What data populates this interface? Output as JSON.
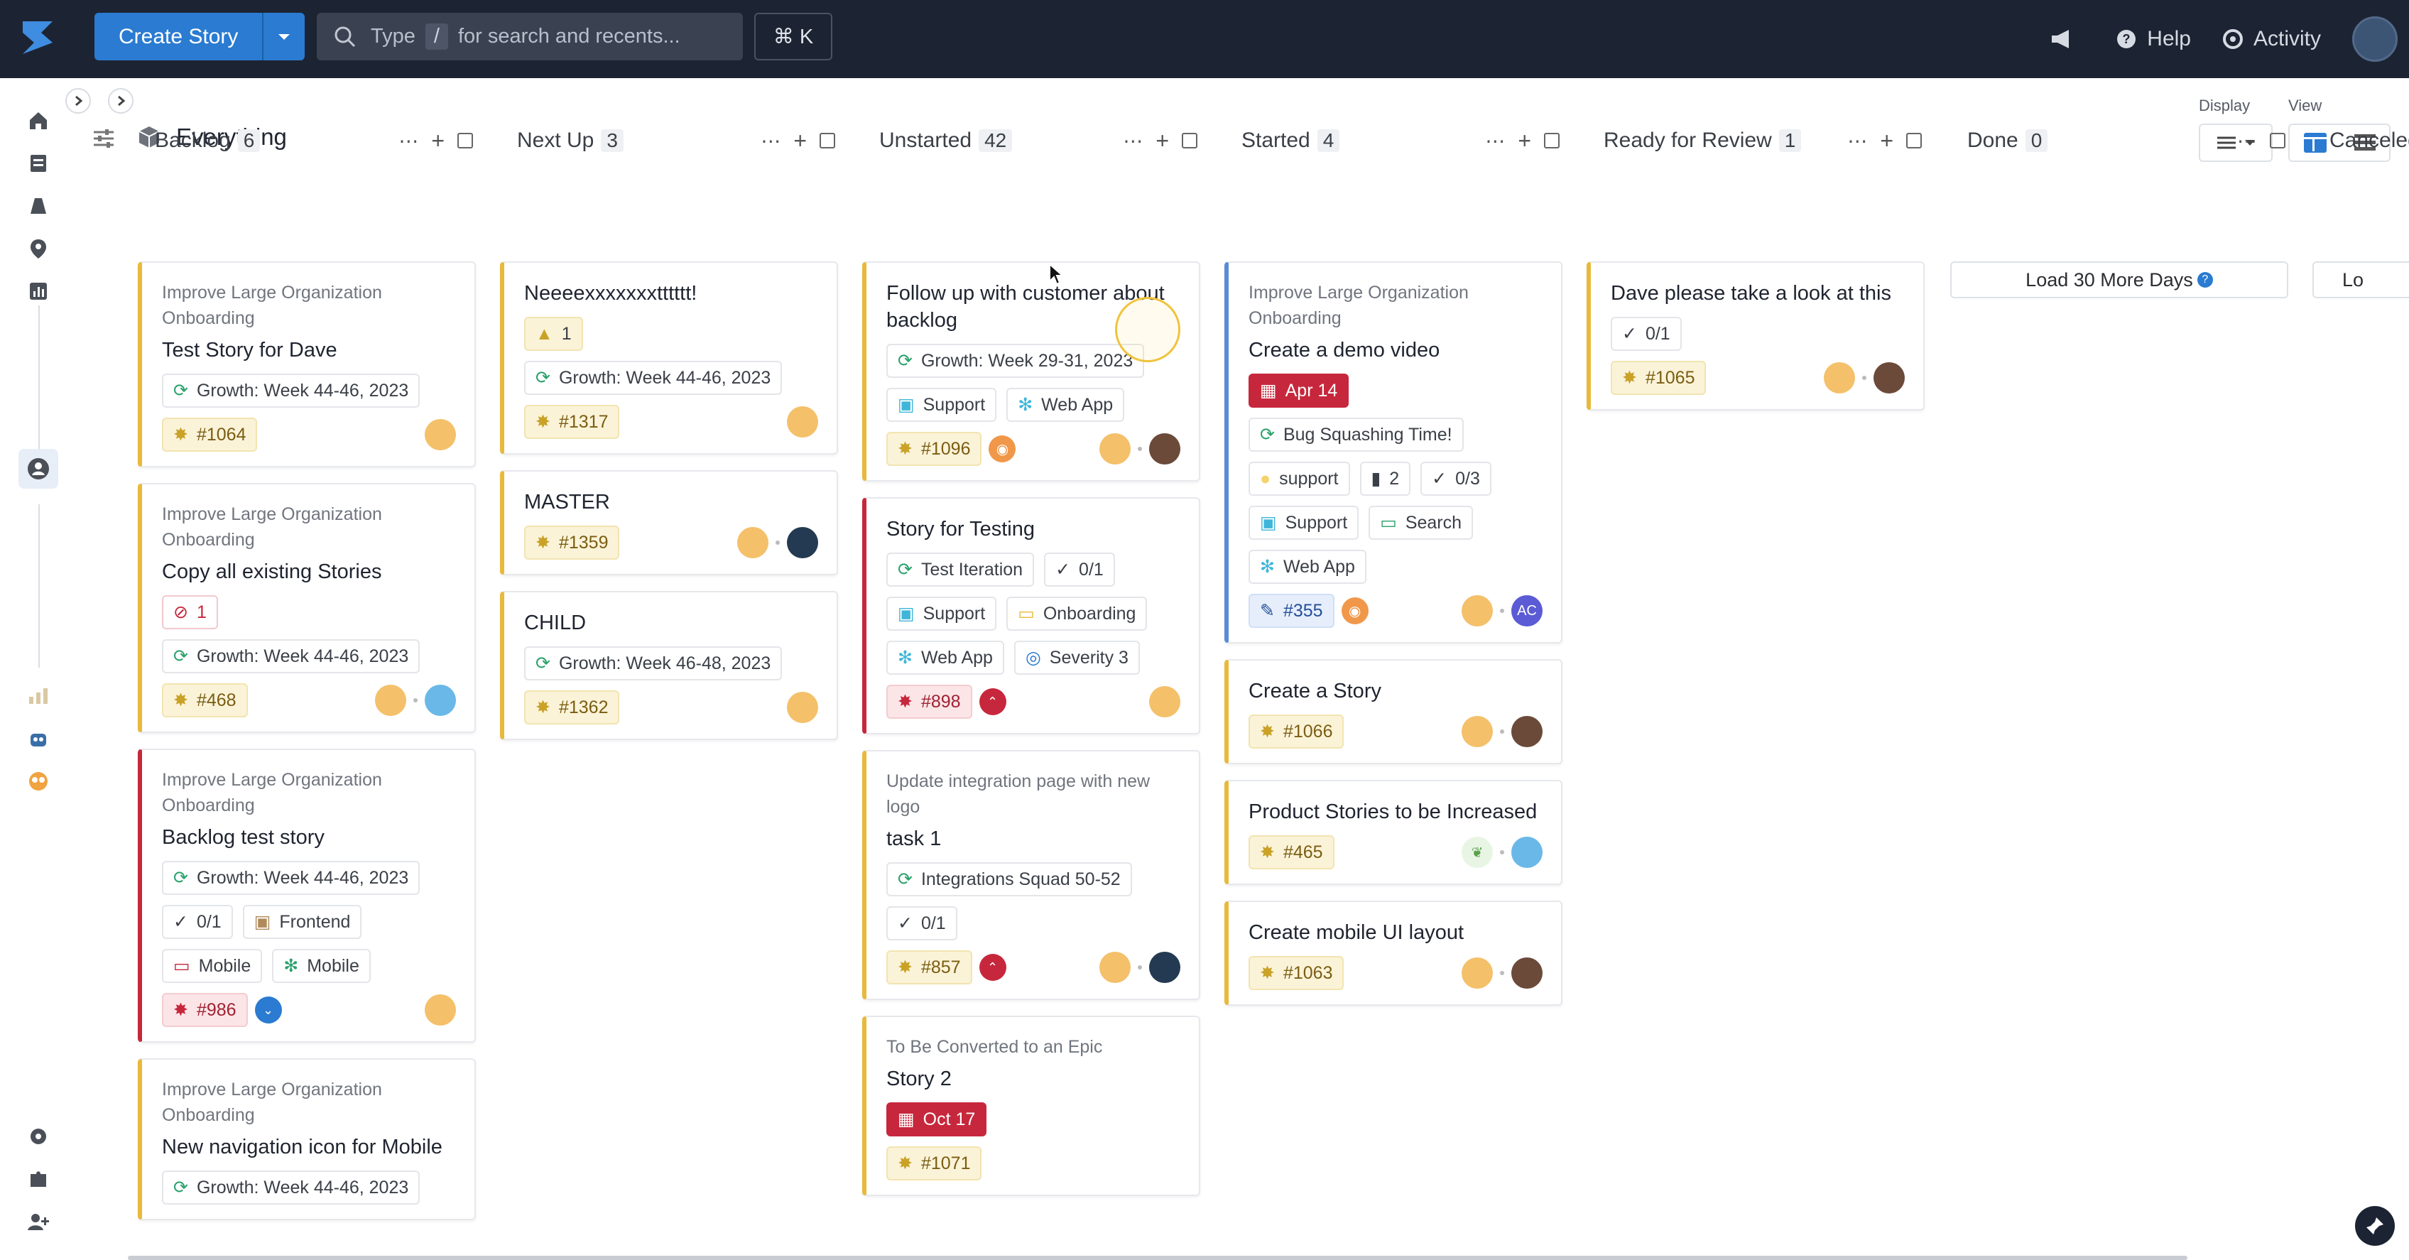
{
  "topbar": {
    "create_label": "Create Story",
    "search_placeholder_pre": "Type",
    "search_key": "/",
    "search_placeholder_post": "for search and recents...",
    "cmdk": "⌘ K",
    "help_label": "Help",
    "activity_label": "Activity"
  },
  "page": {
    "title": "Everything",
    "display_label": "Display",
    "view_label": "View"
  },
  "columns": [
    {
      "name": "Backlog",
      "count": "6"
    },
    {
      "name": "Next Up",
      "count": "3"
    },
    {
      "name": "Unstarted",
      "count": "42"
    },
    {
      "name": "Started",
      "count": "4"
    },
    {
      "name": "Ready for Review",
      "count": "1"
    },
    {
      "name": "Done",
      "count": "0"
    },
    {
      "name": "Canceled"
    }
  ],
  "backlog": [
    {
      "epic": "Improve Large Organization Onboarding",
      "title": "Test Story for Dave",
      "iteration": "Growth: Week 44-46, 2023",
      "id": "#1064"
    },
    {
      "epic": "Improve Large Organization Onboarding",
      "title": "Copy all existing Stories",
      "blocked": "1",
      "iteration": "Growth: Week 44-46, 2023",
      "id": "#468"
    },
    {
      "epic": "Improve Large Organization Onboarding",
      "title": "Backlog test story",
      "iteration": "Growth: Week 44-46, 2023",
      "tasks": "0/1",
      "label1": "Frontend",
      "label2": "Mobile",
      "label3": "Mobile",
      "id": "#986"
    },
    {
      "epic": "Improve Large Organization Onboarding",
      "title": "New navigation icon for Mobile",
      "iteration": "Growth: Week 44-46, 2023"
    }
  ],
  "nextup": [
    {
      "title": "Neeeexxxxxxxtttttt!",
      "warn": "1",
      "iteration": "Growth: Week 44-46, 2023",
      "id": "#1317"
    },
    {
      "title": "MASTER",
      "id": "#1359"
    },
    {
      "title": "CHILD",
      "iteration": "Growth: Week 46-48, 2023",
      "id": "#1362"
    }
  ],
  "unstarted": [
    {
      "title": "Follow up with customer about backlog",
      "iteration": "Growth: Week 29-31, 2023",
      "label1": "Support",
      "label2": "Web App",
      "id": "#1096"
    },
    {
      "title": "Story for Testing",
      "iteration": "Test Iteration",
      "tasks": "0/1",
      "label1": "Support",
      "label2": "Onboarding",
      "label3": "Web App",
      "label4": "Severity 3",
      "id": "#898"
    },
    {
      "epic": "Update integration page with new logo",
      "title": "task 1",
      "iteration": "Integrations Squad 50-52",
      "tasks": "0/1",
      "id": "#857"
    },
    {
      "epic": "To Be Converted to an Epic",
      "title": "Story 2",
      "date": "Oct 17",
      "id": "#1071"
    }
  ],
  "started": [
    {
      "epic": "Improve Large Organization Onboarding",
      "title": "Create a demo video",
      "date": "Apr 14",
      "iteration": "Bug Squashing Time!",
      "label1": "support",
      "estimate": "2",
      "tasks": "0/3",
      "label2": "Support",
      "label3": "Search",
      "label4": "Web App",
      "id": "#355",
      "initials": "AC"
    },
    {
      "title": "Create a Story",
      "id": "#1066"
    },
    {
      "title": "Product Stories to be Increased",
      "id": "#465"
    },
    {
      "title": "Create mobile UI layout",
      "id": "#1063"
    }
  ],
  "review": [
    {
      "title": "Dave please take a look at this",
      "tasks": "0/1",
      "id": "#1065"
    }
  ],
  "done": {
    "load_label": "Load 30 More Days",
    "load_label2": "Lo"
  }
}
